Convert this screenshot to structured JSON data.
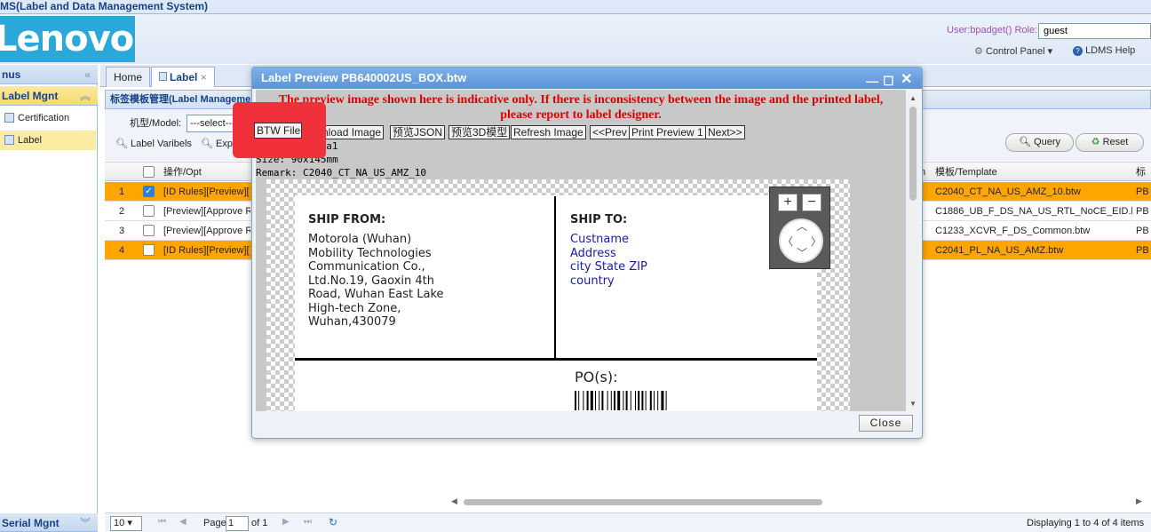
{
  "app": {
    "title": "MS(Label and Data Management System)",
    "logo": "Lenovo"
  },
  "user": {
    "user_text": "User:bpadget()",
    "role_label": "Role:",
    "role_value": "guest"
  },
  "toplinks": {
    "control_panel": "Control Panel",
    "help": "LDMS Help"
  },
  "sidebar": {
    "header": "nus",
    "group": "Label Mgnt",
    "items": [
      {
        "label": "Certification"
      },
      {
        "label": "Label"
      }
    ],
    "footer": "Serial Mgnt"
  },
  "tabs": [
    {
      "label": "Home"
    },
    {
      "label": "Label"
    }
  ],
  "panel": {
    "title": "标签模板管理(Label Manageme"
  },
  "toolbar": {
    "model_label": "机型/Model:",
    "model_select": "---select---",
    "label_variables": "Label Varibels",
    "export": "Exp",
    "query": "Query",
    "reset": "Reset"
  },
  "grid": {
    "headers": {
      "opt": "操作/Opt",
      "template": "模板/Template",
      "col_extra": "标",
      "col_n": "n"
    },
    "rows": [
      {
        "num": "1",
        "opt": "[ID Rules][Preview][",
        "template": "C2040_CT_NA_US_AMZ_10.btw",
        "extra": "PB",
        "checked": true
      },
      {
        "num": "2",
        "opt": "[Preview][Approve R",
        "template": "C1886_UB_F_DS_NA_US_RTL_NoCE_EID.btw",
        "extra": "PB",
        "checked": false
      },
      {
        "num": "3",
        "opt": "[Preview][Approve R",
        "template": "C1233_XCVR_F_DS_Common.btw",
        "extra": "PB",
        "checked": false
      },
      {
        "num": "4",
        "opt": "[ID Rules][Preview][",
        "template": "C2041_PL_NA_US_AMZ.btw",
        "extra": "PB",
        "checked": false
      }
    ]
  },
  "pager": {
    "page_size": "10",
    "page_label": "Page",
    "page_value": "1",
    "of_label": "of 1",
    "display": "Displaying 1 to 4 of 4 items"
  },
  "modal": {
    "title": "Label Preview PB640002US_BOX.btw",
    "warning_line1": "The preview image shown here is indicative only. If there is inconsistency between the image and the printed label,",
    "warning_line2": "please report to label designer.",
    "buttons": {
      "btw": "BTW File",
      "download": "nload Image",
      "json": "预览JSON",
      "model3d": "预览3D模型",
      "refresh": "Refresh Image",
      "prev": "<<Prev",
      "print": "Print Preview 1",
      "next": "Next>>"
    },
    "info": {
      "line1": "nna1",
      "size": "Size: 90x145mm",
      "remark": "Remark: C2040_CT_NA_US_AMZ_10"
    },
    "label": {
      "ship_from": "SHIP FROM:",
      "from_lines": [
        "Motorola (Wuhan)",
        "Mobility Technologies",
        "Communication Co.,",
        "Ltd.No.19, Gaoxin 4th",
        "Road, Wuhan East Lake",
        "High-tech Zone,",
        "Wuhan,430079"
      ],
      "ship_to": "SHIP TO:",
      "to_lines": [
        "Custname",
        "Address",
        "city State ZIP",
        "country"
      ],
      "po": "PO(s):"
    },
    "close": "Close"
  },
  "colors": {
    "highlight": "#ffa500",
    "accent": "#5b93d8",
    "warning": "#e00000",
    "ship_to_text": "#1a1aa8"
  }
}
